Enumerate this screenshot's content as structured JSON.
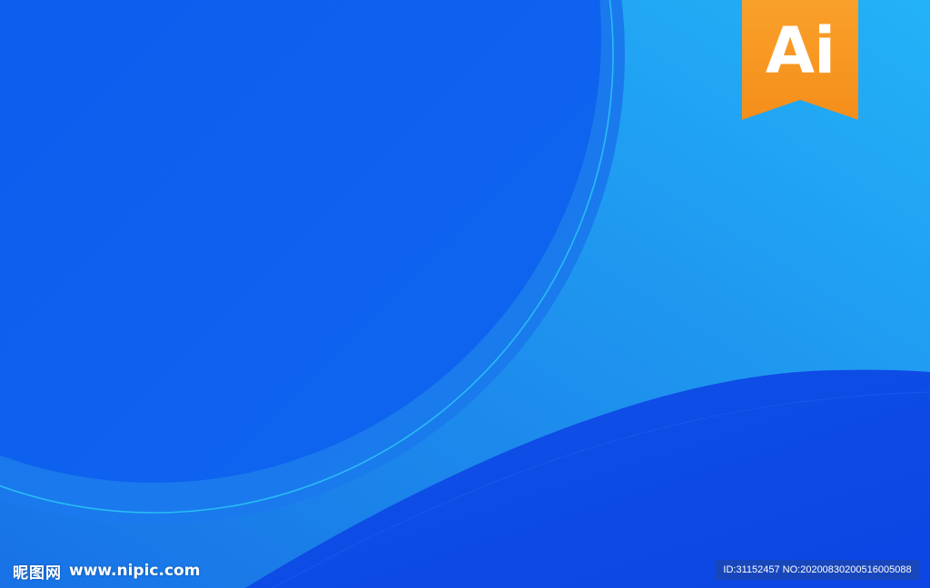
{
  "logo": {
    "text": "Ai",
    "color": "#f7941d"
  },
  "watermark": {
    "site_name": "昵图网",
    "site_url": "www.nipic.com",
    "id_info": "ID:31152457 NO:20200830200516005088"
  },
  "colors": {
    "background_light": "#22a9f4",
    "background_mid": "#1e8fea",
    "circle_fill": "#0d5fef",
    "bottom_wave": "#0e4be6",
    "accent_line": "#29c7f5"
  }
}
